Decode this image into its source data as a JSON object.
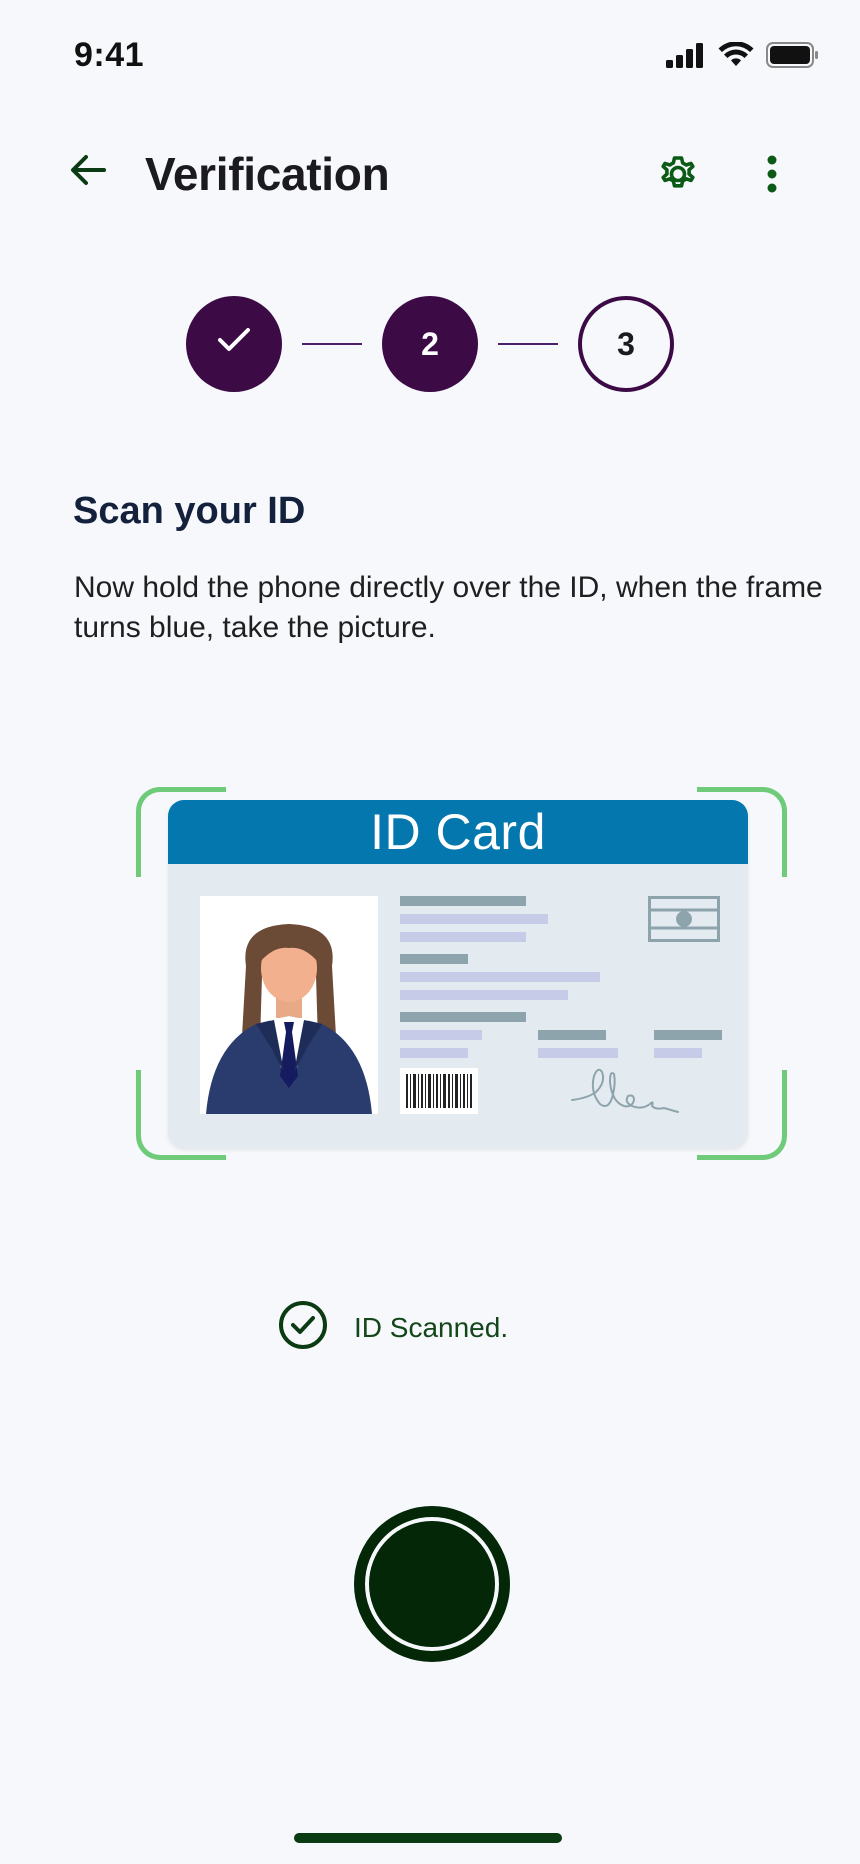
{
  "status_bar": {
    "time": "9:41",
    "icons": [
      "signal-icon",
      "wifi-icon",
      "battery-icon"
    ]
  },
  "app_bar": {
    "title": "Verification",
    "back_icon": "arrow-left-icon",
    "settings_icon": "gear-icon",
    "more_icon": "more-vertical-icon"
  },
  "stepper": {
    "steps": [
      {
        "label": "",
        "state": "complete"
      },
      {
        "label": "2",
        "state": "current"
      },
      {
        "label": "3",
        "state": "upcoming"
      }
    ]
  },
  "content": {
    "title": "Scan your ID",
    "instructions": "Now hold the phone directly over the ID, when the frame turns blue, take the picture."
  },
  "id_card": {
    "header": "ID Card"
  },
  "scan_status": {
    "text": "ID Scanned.",
    "icon": "check-circle-icon"
  },
  "colors": {
    "primary": "#3c0a45",
    "accent_green": "#0b3b12",
    "frame_green": "#6fcb7a",
    "card_header_blue": "#0477ae"
  }
}
